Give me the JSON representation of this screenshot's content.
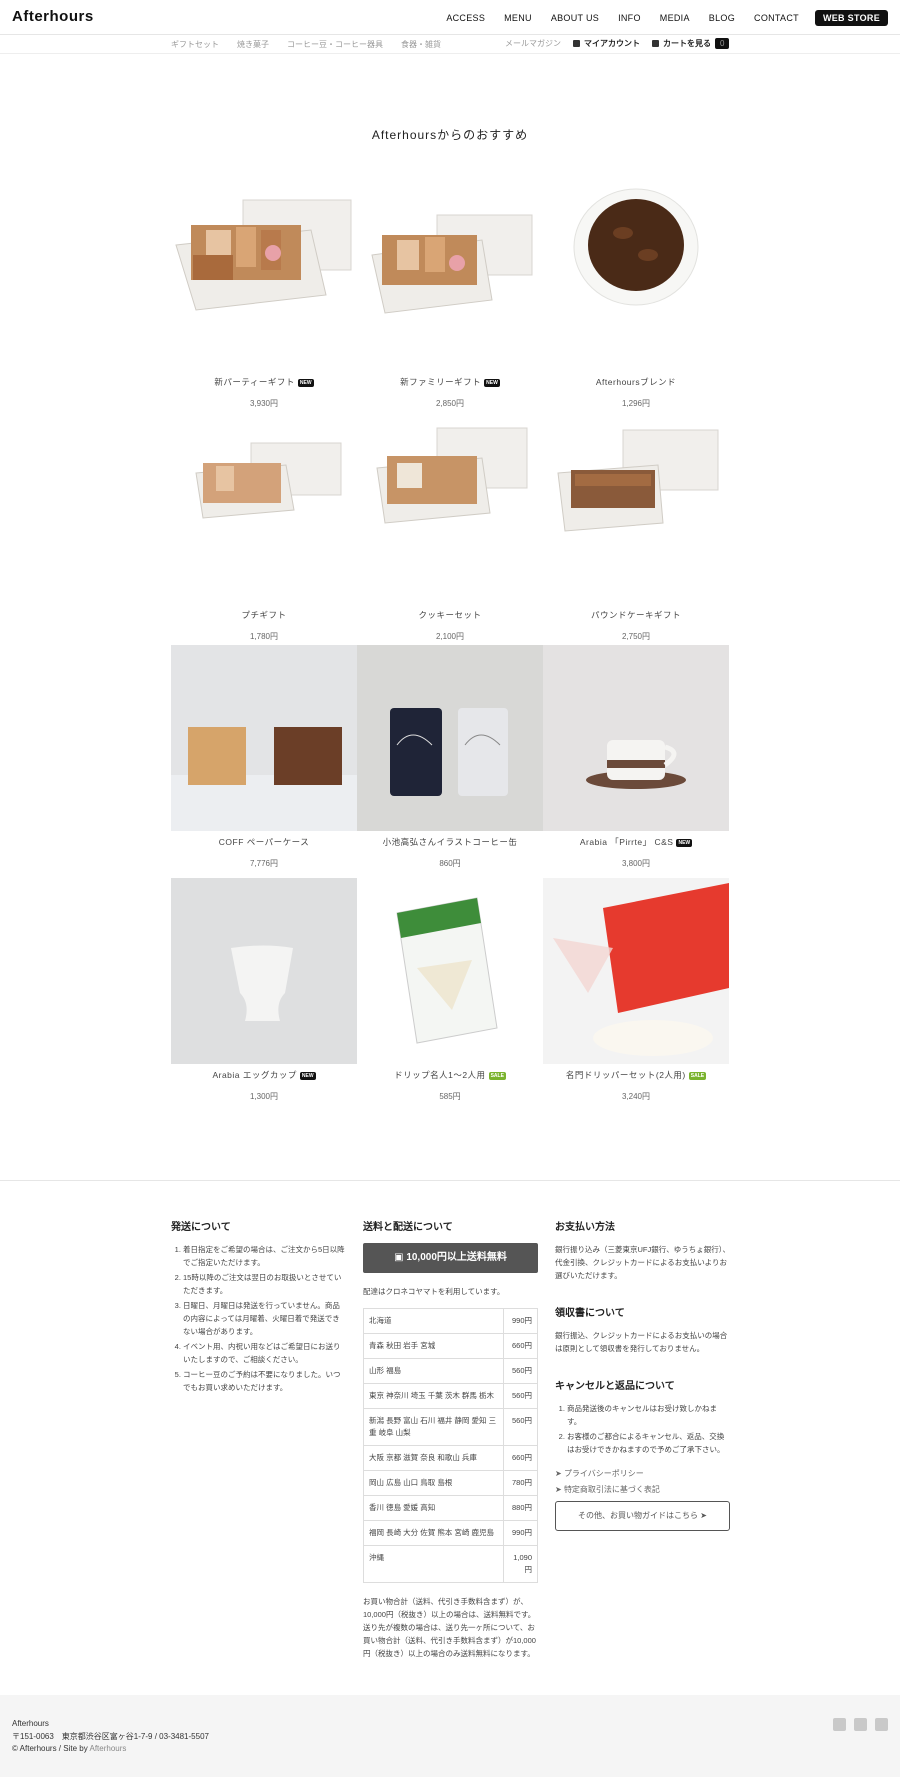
{
  "header": {
    "logo": "Afterhours",
    "nav": [
      "ACCESS",
      "MENU",
      "ABOUT US",
      "INFO",
      "MEDIA",
      "BLOG",
      "CONTACT"
    ],
    "store": "WEB STORE"
  },
  "subnav": {
    "categories": [
      "ギフトセット",
      "焼き菓子",
      "コーヒー豆・コーヒー器具",
      "食器・雑貨"
    ],
    "newsletter": "メールマガジン",
    "account": "マイアカウント",
    "cart": "カートを見る",
    "cart_count": "0"
  },
  "section_title": "Afterhoursからのおすすめ",
  "products": [
    {
      "name": "新パーティーギフト",
      "price": "3,930円",
      "badge": "NEW"
    },
    {
      "name": "新ファミリーギフト",
      "price": "2,850円",
      "badge": "NEW"
    },
    {
      "name": "Afterhoursブレンド",
      "price": "1,296円",
      "badge": ""
    },
    {
      "name": "プチギフト",
      "price": "1,780円",
      "badge": ""
    },
    {
      "name": "クッキーセット",
      "price": "2,100円",
      "badge": ""
    },
    {
      "name": "パウンドケーキギフト",
      "price": "2,750円",
      "badge": ""
    },
    {
      "name": "COFF ペーパーケース",
      "price": "7,776円",
      "badge": ""
    },
    {
      "name": "小池高弘さんイラストコーヒー缶",
      "price": "860円",
      "badge": ""
    },
    {
      "name": "Arabia 「Pirrte」 C&S",
      "price": "3,800円",
      "badge": "NEW"
    },
    {
      "name": "Arabia エッグカップ",
      "price": "1,300円",
      "badge": "NEW"
    },
    {
      "name": "ドリップ名人1〜2人用",
      "price": "585円",
      "badge": "SALE"
    },
    {
      "name": "名門ドリッパーセット(2人用)",
      "price": "3,240円",
      "badge": "SALE"
    }
  ],
  "shipping_info": {
    "title": "発送について",
    "items": [
      "着日指定をご希望の場合は、ご注文から5日以降でご指定いただけます。",
      "15時以降のご注文は翌日のお取扱いとさせていただきます。",
      "日曜日、月曜日は発送を行っていません。商品の内容によっては月曜着、火曜日着で発送できない場合があります。",
      "イベント用、内祝い用などはご希望日にお送りいたしますので、ご相談ください。",
      "コーヒー豆のご予約は不要になりました。いつでもお買い求めいただけます。"
    ]
  },
  "delivery": {
    "title": "送料と配送について",
    "free_label": "10,000円以上送料無料",
    "carrier": "配達はクロネコヤマトを利用しています。",
    "rates": [
      {
        "region": "北海道",
        "price": "990円"
      },
      {
        "region": "青森 秋田 岩手 宮城",
        "price": "660円"
      },
      {
        "region": "山形 福島",
        "price": "560円"
      },
      {
        "region": "東京 神奈川 埼玉 千葉 茨木 群馬 栃木",
        "price": "560円"
      },
      {
        "region": "新潟 長野 富山 石川 福井 静岡 愛知 三重 岐阜 山梨",
        "price": "560円"
      },
      {
        "region": "大阪 京都 滋賀 奈良 和歌山 兵庫",
        "price": "660円"
      },
      {
        "region": "岡山 広島 山口 鳥取 島根",
        "price": "780円"
      },
      {
        "region": "香川 徳島 愛媛 高知",
        "price": "880円"
      },
      {
        "region": "福岡 長崎 大分 佐賀 熊本 宮崎 鹿児島",
        "price": "990円"
      },
      {
        "region": "沖縄",
        "price": "1,090円"
      }
    ],
    "note": "お買い物合計（送料、代引き手数料含まず）が、10,000円（税抜き）以上の場合は、送料無料です。送り先が複数の場合は、送り先一ヶ所について、お買い物合計（送料、代引き手数料含まず）が10,000円（税抜き）以上の場合のみ送料無料になります。"
  },
  "payment": {
    "title": "お支払い方法",
    "text": "銀行振り込み（三菱東京UFJ銀行、ゆうちょ銀行）、代金引換、クレジットカードによるお支払いよりお選びいただけます。"
  },
  "receipt": {
    "title": "領収書について",
    "text": "銀行振込、クレジットカードによるお支払いの場合は原則として領収書を発行しておりません。"
  },
  "cancel": {
    "title": "キャンセルと返品について",
    "items": [
      "商品発送後のキャンセルはお受け致しかねます。",
      "お客様のご都合によるキャンセル、返品、交換はお受けできかねますので予めご了承下さい。"
    ]
  },
  "links": [
    "プライバシーポリシー",
    "特定商取引法に基づく表記"
  ],
  "guide_button": "その他、お買い物ガイドはこちら",
  "footer": {
    "name": "Afterhours",
    "address": "〒151-0063　東京都渋谷区富ヶ谷1-7-9 / 03-3481-5507",
    "copyright": "© Afterhours / Site by ",
    "site_by": "Afterhours",
    "social": [
      "instagram-icon",
      "facebook-icon",
      "twitter-icon"
    ]
  }
}
